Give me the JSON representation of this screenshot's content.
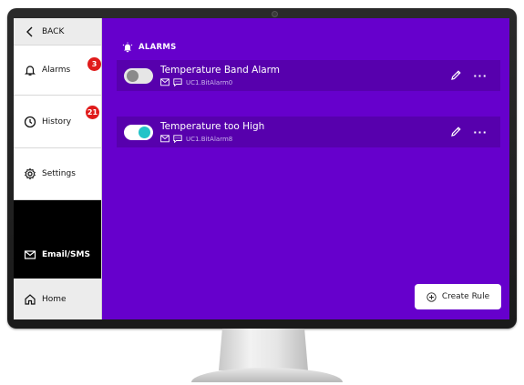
{
  "sidebar": {
    "back_label": "BACK",
    "items": [
      {
        "label": "Alarms",
        "badge": "3"
      },
      {
        "label": "History",
        "badge": "21"
      },
      {
        "label": "Settings"
      },
      {
        "label": "Email/SMS"
      },
      {
        "label": "Home"
      }
    ]
  },
  "header": {
    "title": "ALARMS"
  },
  "alarms": [
    {
      "title": "Temperature Band Alarm",
      "tag": "UC1.BitAlarm0",
      "enabled": false
    },
    {
      "title": "Temperature too High",
      "tag": "UC1.BitAlarm8",
      "enabled": true
    }
  ],
  "actions": {
    "create_rule_label": "Create Rule"
  },
  "colors": {
    "screen_bg": "#6600cc",
    "card_bg": "#5700ad",
    "toggle_on": "#22c3c8",
    "badge": "#e01b1b"
  }
}
